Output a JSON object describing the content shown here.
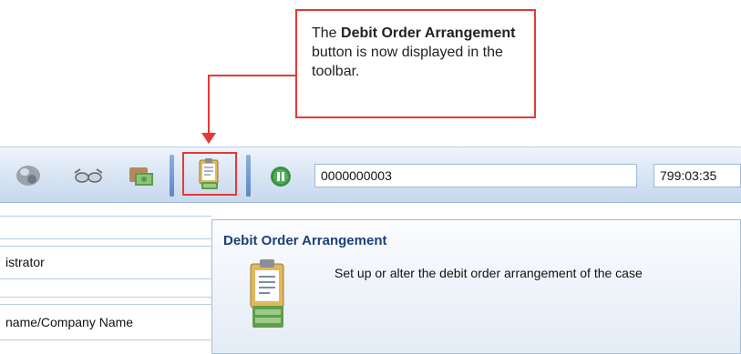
{
  "callout": {
    "prefix": "The ",
    "bold": "Debit Order Arrangement",
    "suffix": " button is now displayed in the toolbar."
  },
  "toolbar": {
    "icons": [
      "helmet-icon",
      "glasses-icon",
      "money-icon",
      "debit-order-arrangement-icon",
      "pause-icon"
    ],
    "case_number": "0000000003",
    "timer": "799:03:35"
  },
  "form": {
    "field1_text": "istrator",
    "field2_text": "name/Company Name"
  },
  "tooltip": {
    "title": "Debit Order Arrangement",
    "description": "Set up or alter the debit order arrangement of the case"
  },
  "colors": {
    "callout_border": "#e53935",
    "tooltip_title": "#1f3f78"
  }
}
